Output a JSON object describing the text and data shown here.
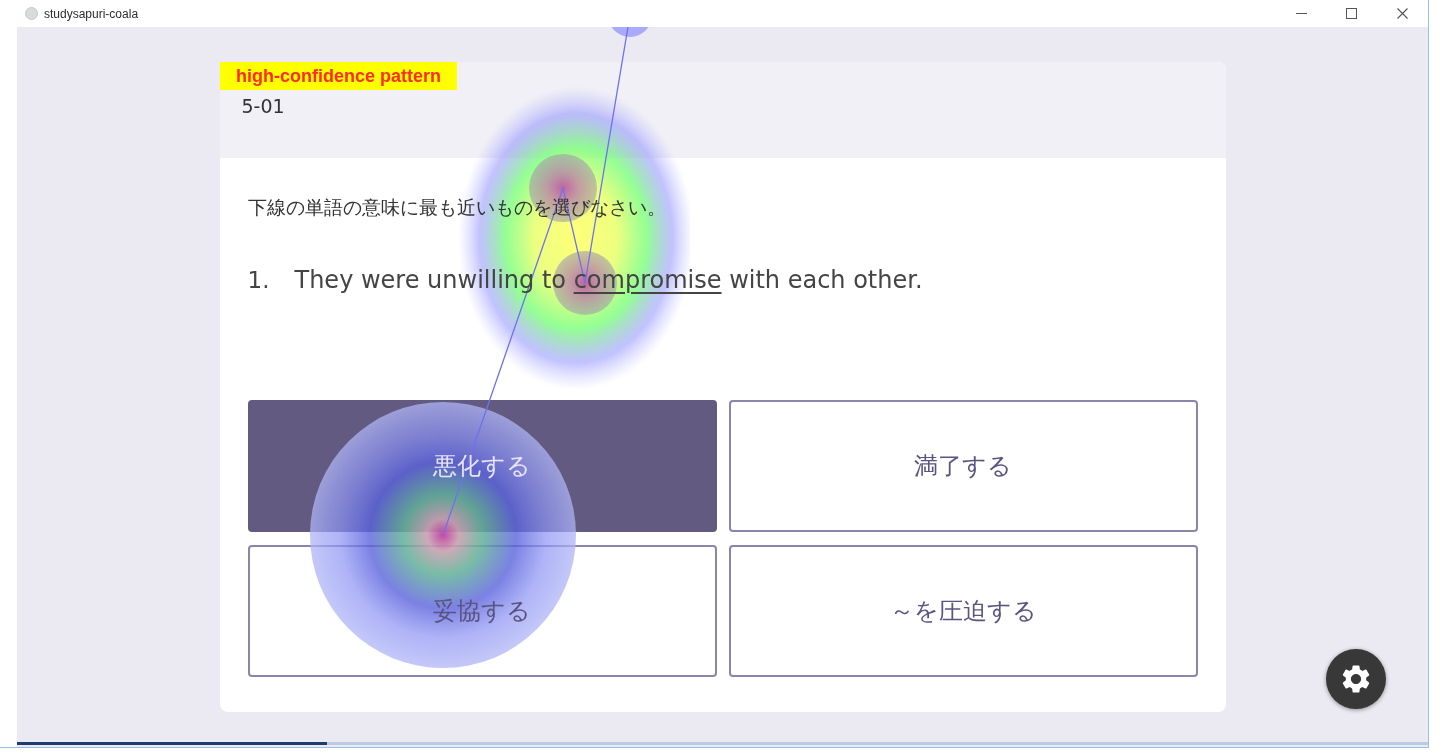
{
  "window": {
    "title": "studysapuri-coala"
  },
  "annotation": {
    "label": "high-confidence pattern"
  },
  "card": {
    "header": "5-01",
    "instruction": "下線の単語の意味に最も近いものを選びなさい。",
    "question": {
      "number": "1.",
      "before": "They were unwilling to",
      "target": "compromise",
      "after": "with each other."
    },
    "options": [
      {
        "label": "悪化する",
        "selected": true
      },
      {
        "label": "満了する",
        "selected": false
      },
      {
        "label": "妥協する",
        "selected": false
      },
      {
        "label": "～を圧迫する",
        "selected": false
      }
    ]
  },
  "progress": {
    "level": 0.22
  }
}
